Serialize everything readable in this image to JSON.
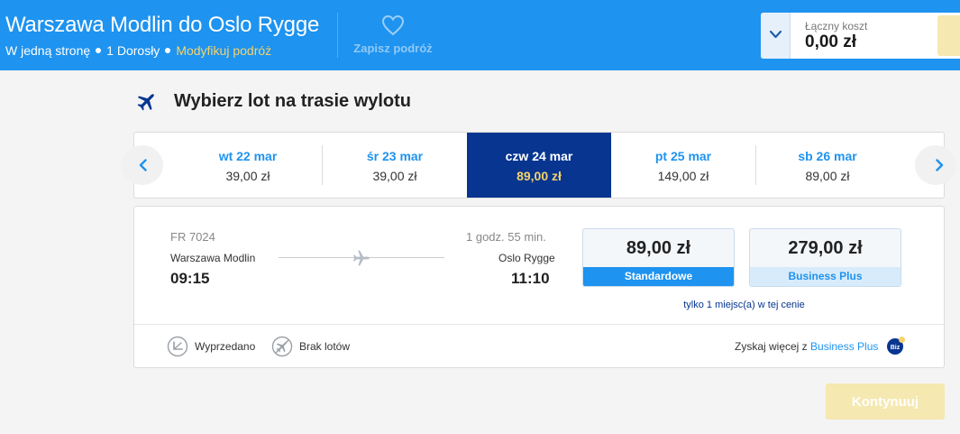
{
  "header": {
    "route_title": "Warszawa Modlin do Oslo Rygge",
    "trip_type": "W jedną stronę",
    "passengers": "1 Dorosły",
    "modify_link": "Modyfikuj podróż",
    "save_trip": "Zapisz podróż",
    "total_cost_label": "Łączny koszt",
    "total_cost_value": "0,00 zł"
  },
  "section": {
    "title": "Wybierz lot na trasie wylotu"
  },
  "dates": [
    {
      "label": "wt 22 mar",
      "price": "39,00 zł"
    },
    {
      "label": "śr 23 mar",
      "price": "39,00 zł"
    },
    {
      "label": "czw 24 mar",
      "price": "89,00 zł",
      "selected": true
    },
    {
      "label": "pt 25 mar",
      "price": "149,00 zł"
    },
    {
      "label": "sb 26 mar",
      "price": "89,00 zł"
    }
  ],
  "flight": {
    "number": "FR 7024",
    "duration": "1 godz. 55 min.",
    "departure_airport": "Warszawa Modlin",
    "departure_time": "09:15",
    "arrival_airport": "Oslo Rygge",
    "arrival_time": "11:10",
    "fares": [
      {
        "price": "89,00 zł",
        "name": "Standardowe"
      },
      {
        "price": "279,00 zł",
        "name": "Business Plus"
      }
    ],
    "seats_note": "tylko 1 miejsc(a) w tej cenie"
  },
  "legend": {
    "sold_out": "Wyprzedano",
    "no_flights": "Brak lotów",
    "upsell_text": "Zyskaj więcej z",
    "upsell_link": "Business Plus",
    "biz_badge": "Biz"
  },
  "actions": {
    "continue": "Kontynuuj"
  },
  "colors": {
    "brand_blue": "#1e93ef",
    "dark_blue": "#073590",
    "accent_yellow": "#f5d36c",
    "disabled_yellow": "#f5e8b0"
  }
}
